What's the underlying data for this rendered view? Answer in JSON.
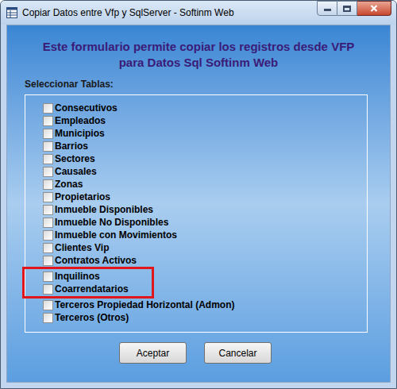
{
  "window": {
    "title": "Copiar Datos entre Vfp y SqlServer - Softinm Web"
  },
  "heading": [
    "Este formulario permite copiar los registros desde VFP",
    "para Datos Sql Softinm Web"
  ],
  "tables_label": "Seleccionar Tablas:",
  "tables": [
    {
      "label": "Consecutivos",
      "checked": false,
      "highlighted": false
    },
    {
      "label": "Empleados",
      "checked": false,
      "highlighted": false
    },
    {
      "label": "Municipios",
      "checked": false,
      "highlighted": false
    },
    {
      "label": "Barrios",
      "checked": false,
      "highlighted": false
    },
    {
      "label": "Sectores",
      "checked": false,
      "highlighted": false
    },
    {
      "label": "Causales",
      "checked": false,
      "highlighted": false
    },
    {
      "label": "Zonas",
      "checked": false,
      "highlighted": false
    },
    {
      "label": "Propietarios",
      "checked": false,
      "highlighted": false
    },
    {
      "label": "Inmueble Disponibles",
      "checked": false,
      "highlighted": false
    },
    {
      "label": "Inmueble No Disponibles",
      "checked": false,
      "highlighted": false
    },
    {
      "label": "Inmueble con Movimientos",
      "checked": false,
      "highlighted": false
    },
    {
      "label": "Clientes Vip",
      "checked": false,
      "highlighted": false
    },
    {
      "label": "Contratos Activos",
      "checked": false,
      "highlighted": false
    },
    {
      "label": "Inquilinos",
      "checked": false,
      "highlighted": true
    },
    {
      "label": "Coarrendatarios",
      "checked": false,
      "highlighted": true
    },
    {
      "label": "Terceros Propiedad Horizontal (Admon)",
      "checked": false,
      "highlighted": false
    },
    {
      "label": "Terceros (Otros)",
      "checked": false,
      "highlighted": false
    }
  ],
  "buttons": [
    "Aceptar",
    "Cancelar"
  ]
}
